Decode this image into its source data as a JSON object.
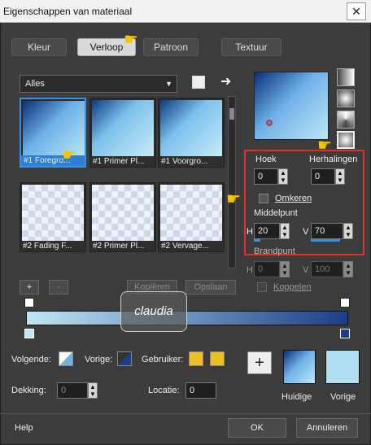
{
  "window": {
    "title": "Eigenschappen van materiaal",
    "close": "✕"
  },
  "tabs": [
    {
      "label": "Kleur"
    },
    {
      "label": "Verloop"
    },
    {
      "label": "Patroon"
    },
    {
      "label": "Textuur"
    }
  ],
  "filter": {
    "value": "Alles"
  },
  "thumbnails": [
    {
      "caption": "#1 Foregro..."
    },
    {
      "caption": "#1 Primer Pl..."
    },
    {
      "caption": "#1 Voorgro..."
    },
    {
      "caption": "#2 Fading F..."
    },
    {
      "caption": "#2 Primer Pl..."
    },
    {
      "caption": "#2 Vervage..."
    }
  ],
  "settings": {
    "hoek_label": "Hoek",
    "hoek_value": "0",
    "herhalingen_label": "Herhalingen",
    "herhalingen_value": "0",
    "omkeren_label": "Omkeren",
    "middelpunt_label": "Middelpunt",
    "h_label": "H",
    "h_value": "20",
    "v_label": "V",
    "v_value": "70",
    "brandpunt_label": "Brandpunt",
    "bh_value": "0",
    "bv_value": "100",
    "koppelen_label": "Koppelen"
  },
  "gradient_bar": {
    "add": "+",
    "remove": "-",
    "save_as": "Kopiëren",
    "save": "Opslaan",
    "watermark": "claudia"
  },
  "colors": {
    "volgende_label": "Volgende:",
    "vorige_label": "Vorige:",
    "gebruiker_label": "Gebruiker:",
    "huidige_label": "Huidige",
    "vorige2_label": "Vorige",
    "gebruiker_color": "#f0c020"
  },
  "dekking_label": "Dekking:",
  "dekking_value": "0",
  "locatie_label": "Locatie:",
  "locatie_value": "0",
  "footer": {
    "help": "Help",
    "ok": "OK",
    "cancel": "Annuleren"
  }
}
